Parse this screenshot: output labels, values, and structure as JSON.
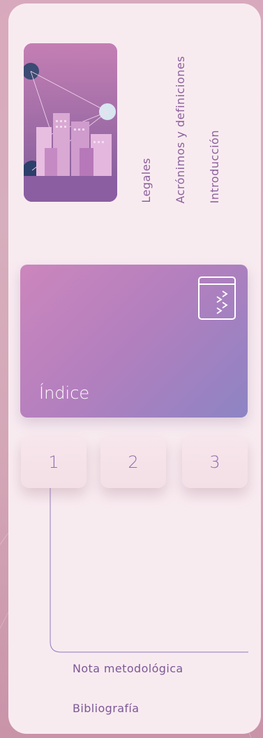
{
  "nav": {
    "vertical_links": [
      "Legales",
      "Acrónimos y definiciones",
      "Introducción"
    ]
  },
  "index_card": {
    "title": "Índice",
    "icon": "collapse-panel-icon"
  },
  "chapters": [
    "1",
    "2",
    "3"
  ],
  "bottom_links": [
    "Nota metodológica",
    "Bibliografía"
  ],
  "colors": {
    "panel": "#f8ebf0",
    "accent_text": "#8c5f9c",
    "card_gradient_start": "#cc86bd",
    "card_gradient_end": "#8d84c4",
    "number_text": "#8e6fb0"
  }
}
